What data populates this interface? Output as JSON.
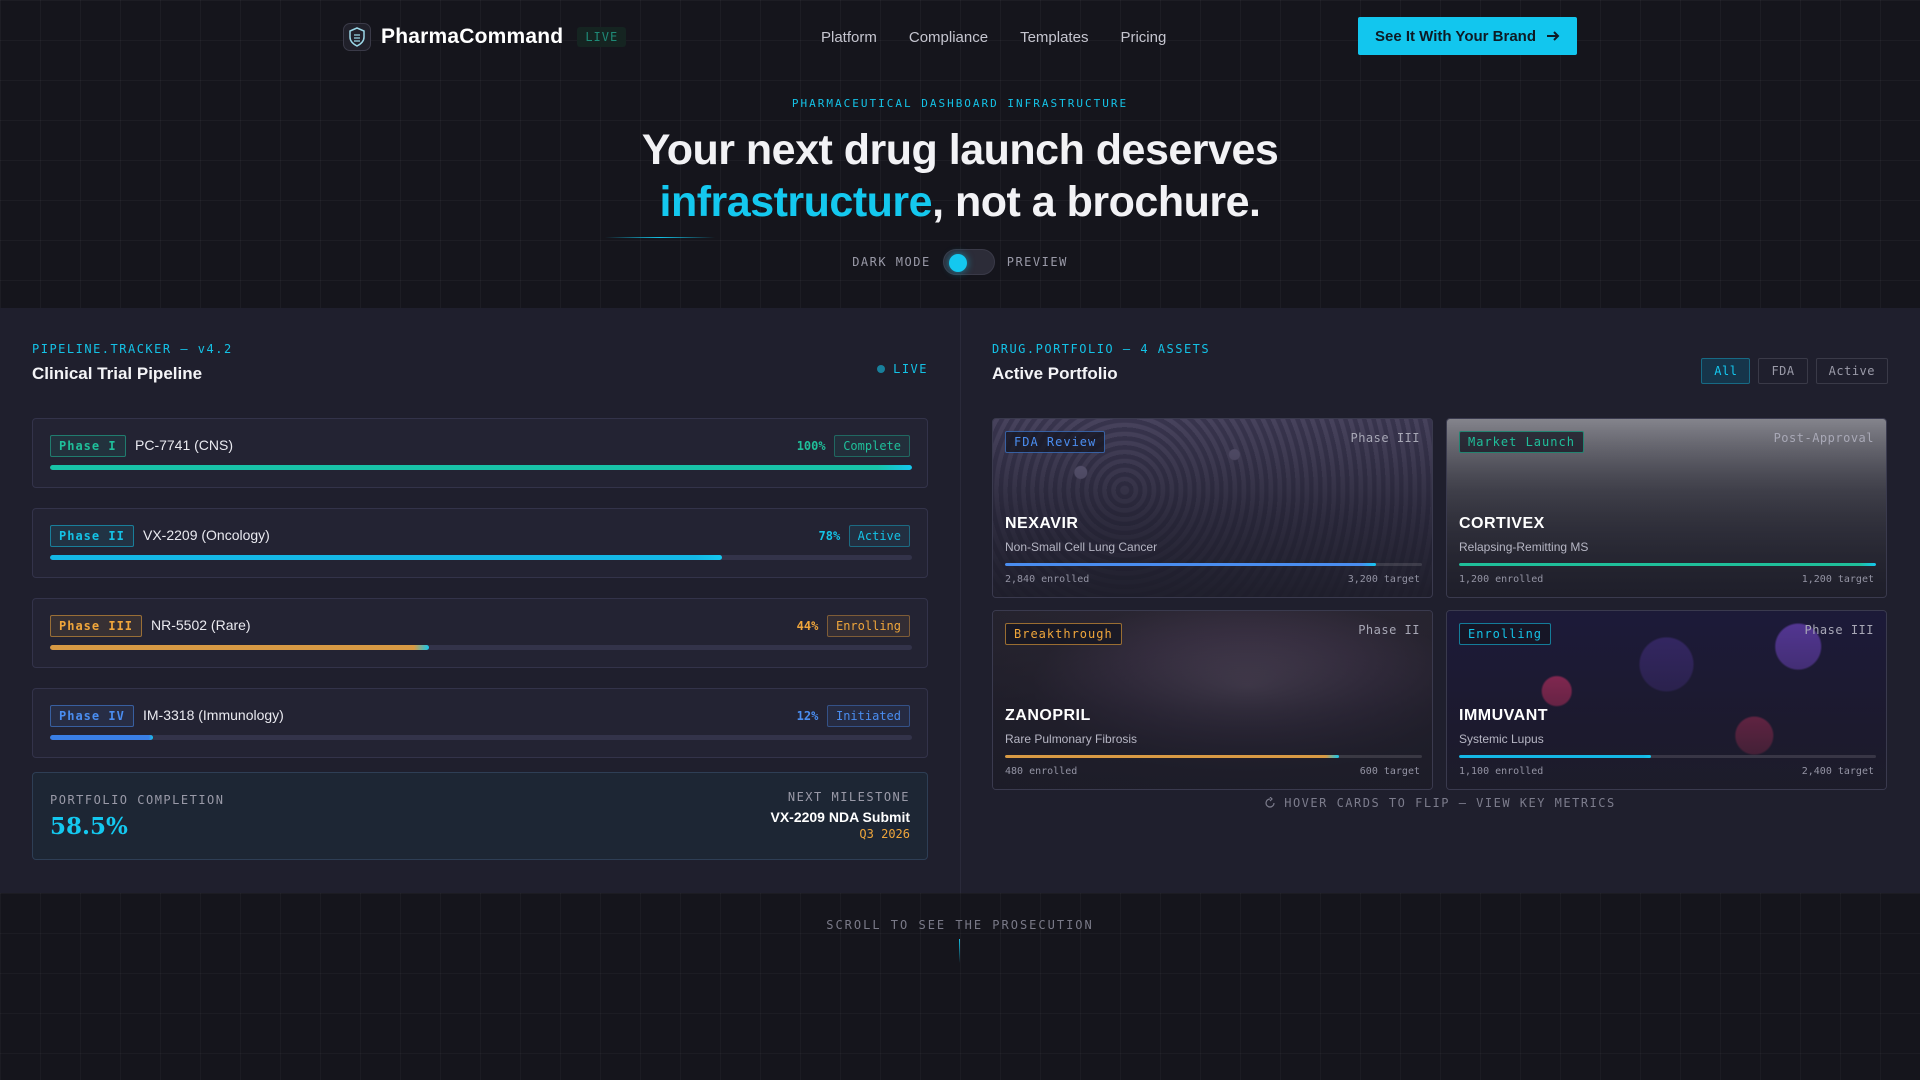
{
  "nav": {
    "brand": "PharmaCommand",
    "brand_badge": "LIVE",
    "links": [
      "Platform",
      "Compliance",
      "Templates",
      "Pricing"
    ],
    "cta": "See It With Your Brand"
  },
  "hero": {
    "eyebrow": "PHARMACEUTICAL DASHBOARD INFRASTRUCTURE",
    "headline_line1": "Your next drug launch deserves",
    "headline_accent": "infrastructure",
    "headline_rest": ", not a brochure.",
    "toggle_left": "DARK MODE",
    "toggle_right": "PREVIEW"
  },
  "pipeline": {
    "kicker": "PIPELINE.TRACKER — v4.2",
    "title": "Clinical Trial Pipeline",
    "live": "LIVE",
    "trials": [
      {
        "phase": "Phase I",
        "name": "PC-7741 (CNS)",
        "pct": "100%",
        "progress": 1.0,
        "status": "Complete",
        "color": "#1fbf9a",
        "fill": "#18c3a8"
      },
      {
        "phase": "Phase II",
        "name": "VX-2209 (Oncology)",
        "pct": "78%",
        "progress": 0.78,
        "status": "Active",
        "color": "#14c2e6",
        "fill": "#14b8e6"
      },
      {
        "phase": "Phase III",
        "name": "NR-5502 (Rare)",
        "pct": "44%",
        "progress": 0.44,
        "status": "Enrolling",
        "color": "#f0a63b",
        "fill": "#d89a44"
      },
      {
        "phase": "Phase IV",
        "name": "IM-3318 (Immunology)",
        "pct": "12%",
        "progress": 0.12,
        "status": "Initiated",
        "color": "#4a8df0",
        "fill": "#3a7fe6"
      }
    ],
    "summary": {
      "label": "PORTFOLIO COMPLETION",
      "value": "58.5%",
      "milestone_label": "NEXT MILESTONE",
      "milestone_name": "VX-2209 NDA Submit",
      "milestone_date": "Q3 2026"
    }
  },
  "portfolio": {
    "kicker": "DRUG.PORTFOLIO — 4 ASSETS",
    "title": "Active Portfolio",
    "filters": [
      "All",
      "FDA",
      "Active"
    ],
    "active_filter": "All",
    "cards": [
      {
        "tag": "FDA Review",
        "phase": "Phase III",
        "name": "NEXAVIR",
        "indication": "Non-Small Cell Lung Cancer",
        "enrolled": "2,840 enrolled",
        "target": "3,200 target",
        "progress": 0.89,
        "tag_color": "#4a8df0",
        "fill": "#4a8df0",
        "bg": "cells"
      },
      {
        "tag": "Market Launch",
        "phase": "Post-Approval",
        "name": "CORTIVEX",
        "indication": "Relapsing-Remitting MS",
        "enrolled": "1,200 enrolled",
        "target": "1,200 target",
        "progress": 1.0,
        "tag_color": "#1fbf9a",
        "fill": "#1fbf9a",
        "bg": "lab"
      },
      {
        "tag": "Breakthrough",
        "phase": "Phase II",
        "name": "ZANOPRIL",
        "indication": "Rare Pulmonary Fibrosis",
        "enrolled": "480 enrolled",
        "target": "600 target",
        "progress": 0.8,
        "tag_color": "#f0a63b",
        "fill": "#d89a44",
        "bg": "brain"
      },
      {
        "tag": "Enrolling",
        "phase": "Phase III",
        "name": "IMMUVANT",
        "indication": "Systemic Lupus",
        "enrolled": "1,100 enrolled",
        "target": "2,400 target",
        "progress": 0.46,
        "tag_color": "#14c2e6",
        "fill": "#14b8e6",
        "bg": "micro"
      }
    ],
    "hint": "HOVER CARDS TO FLIP — VIEW KEY METRICS"
  },
  "footer": {
    "scroll_hint": "SCROLL TO SEE THE PROSECUTION"
  }
}
